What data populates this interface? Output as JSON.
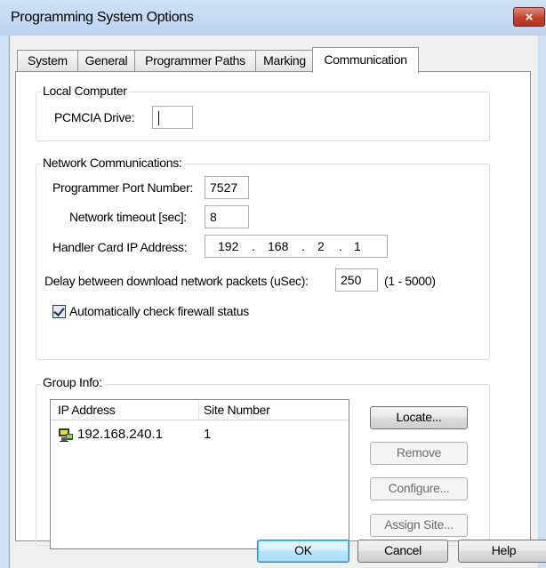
{
  "window": {
    "title": "Programming System Options",
    "close_label": "×"
  },
  "tabs": [
    "System",
    "General",
    "Programmer Paths",
    "Marking",
    "Communication"
  ],
  "local_computer": {
    "legend": "Local Computer",
    "pcmcia_label": "PCMCIA Drive:",
    "pcmcia_value": ""
  },
  "network": {
    "legend": "Network Communications:",
    "port_label": "Programmer Port Number:",
    "port_value": "7527",
    "timeout_label": "Network timeout [sec]:",
    "timeout_value": "8",
    "ip_label": "Handler Card IP Address:",
    "ip_octets": [
      "192",
      "168",
      "2",
      "1"
    ],
    "ip_dot": ".",
    "delay_label": "Delay between download network packets (uSec):",
    "delay_value": "250",
    "delay_range": "(1 - 5000)",
    "firewall_label": "Automatically check firewall status",
    "firewall_checked": true
  },
  "group_info": {
    "legend": "Group Info:",
    "columns": [
      "IP Address",
      "Site Number"
    ],
    "rows": [
      {
        "ip": "192.168.240.1",
        "site": "1",
        "icon": "network-device-icon"
      }
    ],
    "buttons": {
      "locate": "Locate...",
      "remove": "Remove",
      "configure": "Configure...",
      "assign": "Assign Site..."
    }
  },
  "footer": {
    "ok": "OK",
    "cancel": "Cancel",
    "help": "Help"
  },
  "colors": {
    "frame": "#cfe0f2",
    "close": "#c4452f",
    "default_button_border": "#3c7fb1"
  }
}
